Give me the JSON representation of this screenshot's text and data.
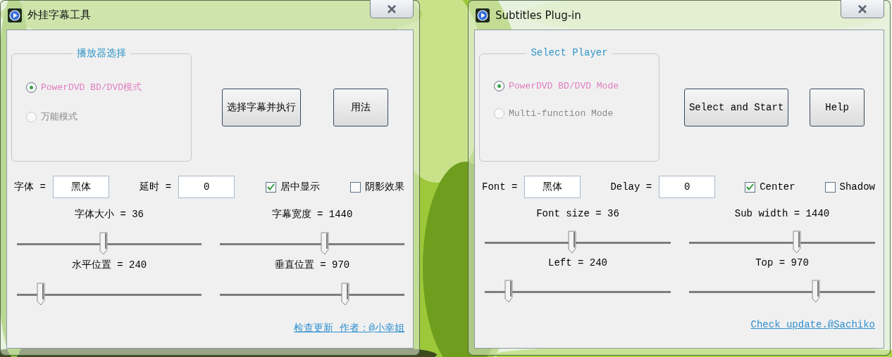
{
  "windows": [
    {
      "title": "外挂字幕工具",
      "group": {
        "title": "播放器选择",
        "options": [
          {
            "label": "PowerDVD BD/DVD模式",
            "selected": true
          },
          {
            "label": "万能模式",
            "selected": false
          }
        ]
      },
      "buttons": [
        "选择字幕并执行",
        "用法"
      ],
      "fields": [
        {
          "label": "字体 =",
          "value": "黑体"
        },
        {
          "label": "延时 =",
          "value": "0"
        }
      ],
      "checkboxes": [
        {
          "label": "居中显示",
          "checked": true
        },
        {
          "label": "阴影效果",
          "checked": false
        }
      ],
      "sliders": [
        {
          "label": "字体大小 = 36",
          "level": 0.47
        },
        {
          "label": "字幕宽度 = 1440",
          "level": 0.57
        },
        {
          "label": "水平位置 = 240",
          "level": 0.13
        },
        {
          "label": "垂直位置 = 970",
          "level": 0.68
        }
      ],
      "link": "检查更新 作者：@小幸姐"
    },
    {
      "title": "Subtitles Plug-in",
      "group": {
        "title": "Select Player",
        "options": [
          {
            "label": "PowerDVD BD/DVD Mode",
            "selected": true
          },
          {
            "label": "Multi-function Mode",
            "selected": false
          }
        ]
      },
      "buttons": [
        "Select and Start",
        "Help"
      ],
      "fields": [
        {
          "label": "Font =",
          "value": "黑体"
        },
        {
          "label": "Delay =",
          "value": "0"
        }
      ],
      "checkboxes": [
        {
          "label": "Center",
          "checked": true
        },
        {
          "label": "Shadow",
          "checked": false
        }
      ],
      "sliders": [
        {
          "label": "Font size = 36",
          "level": 0.47
        },
        {
          "label": "Sub width = 1440",
          "level": 0.58
        },
        {
          "label": "Left = 240",
          "level": 0.13
        },
        {
          "label": "Top = 970",
          "level": 0.68
        }
      ],
      "link": "Check update.@Sachiko"
    }
  ]
}
